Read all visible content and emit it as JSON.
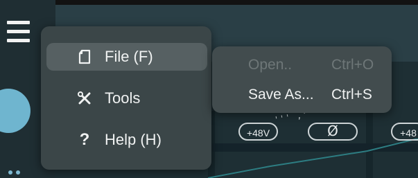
{
  "file_menu": {
    "items": [
      {
        "label": "File (F)",
        "icon": "file-icon"
      },
      {
        "label": "Tools",
        "icon": "tools-icon"
      },
      {
        "label": "Help (H)",
        "icon": "help-icon"
      }
    ]
  },
  "file_submenu": {
    "items": [
      {
        "label": "Open..",
        "shortcut": "Ctrl+O",
        "enabled": false
      },
      {
        "label": "Save As...",
        "shortcut": "Ctrl+S",
        "enabled": true
      }
    ]
  },
  "background": {
    "phantom_label": "+48V",
    "phantom_label_2": "+48",
    "phase_symbol": "Ø",
    "knob_ticks": "''' ,'"
  },
  "colors": {
    "menu_bg": "#3b4648",
    "menu_active": "#566062",
    "submenu_bg": "#424c4e",
    "accent": "#6fb5cf",
    "disabled_text": "#6e7778"
  }
}
